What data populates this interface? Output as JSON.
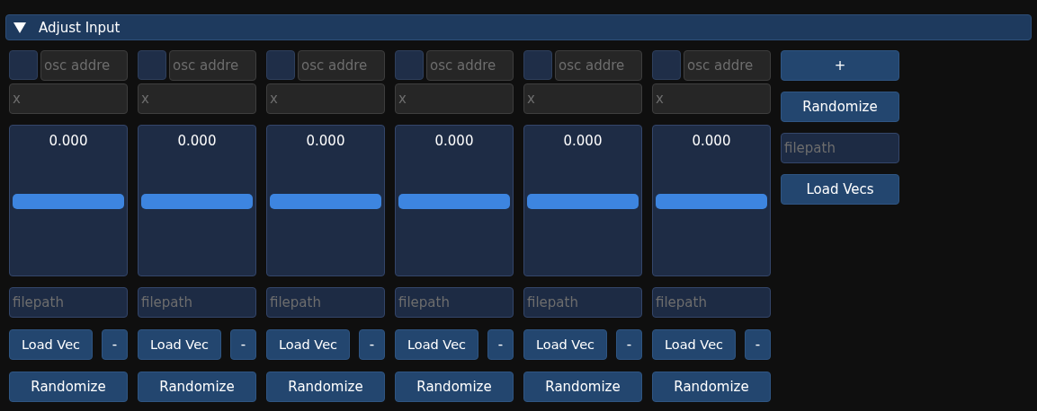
{
  "header": {
    "title": "Adjust Input",
    "expanded": true
  },
  "inputs": [
    {
      "checked": false,
      "osc_placeholder": "osc addre",
      "name_placeholder": "x",
      "value": "0.000",
      "level": 0.5,
      "filepath_placeholder": "filepath",
      "load_label": "Load Vec",
      "remove_label": "-",
      "randomize_label": "Randomize"
    },
    {
      "checked": false,
      "osc_placeholder": "osc addre",
      "name_placeholder": "x",
      "value": "0.000",
      "level": 0.5,
      "filepath_placeholder": "filepath",
      "load_label": "Load Vec",
      "remove_label": "-",
      "randomize_label": "Randomize"
    },
    {
      "checked": false,
      "osc_placeholder": "osc addre",
      "name_placeholder": "x",
      "value": "0.000",
      "level": 0.5,
      "filepath_placeholder": "filepath",
      "load_label": "Load Vec",
      "remove_label": "-",
      "randomize_label": "Randomize"
    },
    {
      "checked": false,
      "osc_placeholder": "osc addre",
      "name_placeholder": "x",
      "value": "0.000",
      "level": 0.5,
      "filepath_placeholder": "filepath",
      "load_label": "Load Vec",
      "remove_label": "-",
      "randomize_label": "Randomize"
    },
    {
      "checked": false,
      "osc_placeholder": "osc addre",
      "name_placeholder": "x",
      "value": "0.000",
      "level": 0.5,
      "filepath_placeholder": "filepath",
      "load_label": "Load Vec",
      "remove_label": "-",
      "randomize_label": "Randomize"
    },
    {
      "checked": false,
      "osc_placeholder": "osc addre",
      "name_placeholder": "x",
      "value": "0.000",
      "level": 0.5,
      "filepath_placeholder": "filepath",
      "load_label": "Load Vec",
      "remove_label": "-",
      "randomize_label": "Randomize"
    }
  ],
  "side": {
    "add_label": "+",
    "randomize_label": "Randomize",
    "filepath_placeholder": "filepath",
    "load_label": "Load Vecs"
  }
}
